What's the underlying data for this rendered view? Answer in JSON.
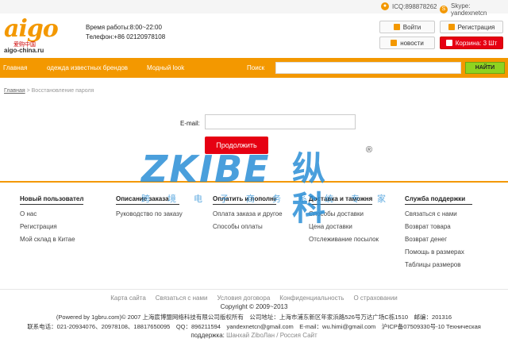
{
  "topbar": {
    "icq": "ICQ:898878262",
    "skype": "Skype: yandexnetcn"
  },
  "logo": {
    "text": "aigo",
    "cn": "爱购中国",
    "domain": "aigo-china.ru"
  },
  "header": {
    "work_hours": "Время работы:8:00~22:00",
    "phone": "Телефон:+86 02120978108",
    "login_label": "Войти",
    "register_label": "Регистрация",
    "news_label": "новости",
    "cart_label": "Корзина: 3 Шт"
  },
  "nav": {
    "items": [
      "Главная",
      "одежда известных брендов",
      "Модный look"
    ],
    "search_label": "Поиск",
    "search_value": "",
    "search_button": "НАЙТИ"
  },
  "breadcrumb": {
    "home": "Главная",
    "separator": " > ",
    "current": "Восстановление пароля"
  },
  "form": {
    "email_label": "E-mail:",
    "email_value": "",
    "continue_label": "Продолжить"
  },
  "watermark": {
    "brand": "ZKIBE",
    "cn": "纵科",
    "sub": "跨境电子商务系统专家",
    "registered": "®"
  },
  "footer": {
    "columns": [
      {
        "title": "Новый пользователь",
        "links": [
          "О нас",
          "Регистрация",
          "Мой склад в Китае"
        ]
      },
      {
        "title": "Описание заказа",
        "links": [
          "Руководство по заказу"
        ]
      },
      {
        "title": "Оплатить и пополнить",
        "links": [
          "Оплата заказа и другое",
          "Способы оплаты"
        ]
      },
      {
        "title": "Доставка и таможня",
        "links": [
          "Способы доставки",
          "Цена доставки",
          "Отслеживание посылок"
        ]
      },
      {
        "title": "Служба поддержки",
        "links": [
          "Связаться с нами",
          "Возврат товара",
          "Возврат денег",
          "Помощь в размерах",
          "Таблицы размеров"
        ]
      }
    ],
    "bottom_links": [
      "Карта сайта",
      "Связаться с нами",
      "Условия договора",
      "Конфиденциальность",
      "О страховании"
    ],
    "copyright": "Copyright © 2009~2013",
    "powered": "(Powered by 1gbru.com)© 2007 上海宸博盟网络科技有限公司版权所有　公司地址：上海市浦东新区年家浜路526号万达广场C栋1510　邮编：201316",
    "contacts": "联系电话：021-20934076、20978108、18817650095　QQ：896211594　yandexnetcn@gmail.com　E-mail：wu.himi@gmail.com　沪ICP备07509330号-10 Техническая",
    "support_prefix": "поддержка:",
    "support_link1": "Шанхай ZiboЛан",
    "support_sep": "/",
    "support_link2": "Россия Сайт"
  }
}
